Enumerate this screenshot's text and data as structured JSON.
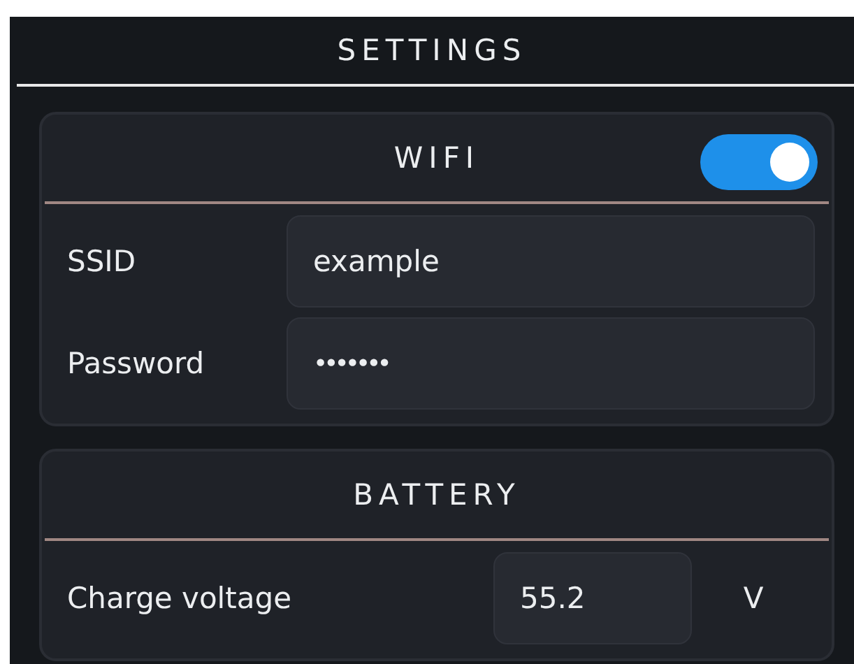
{
  "title": "SETTINGS",
  "sections": [
    {
      "title": "WIFI",
      "toggle": {
        "on": true
      },
      "rows": [
        {
          "kind": "text",
          "label": "SSID",
          "value": "example"
        },
        {
          "kind": "password",
          "label": "Password",
          "value": "•••••••"
        }
      ]
    },
    {
      "title": "BATTERY",
      "rows": [
        {
          "kind": "number",
          "label": "Charge voltage",
          "value": "55.2",
          "unit": "V"
        }
      ]
    }
  ]
}
